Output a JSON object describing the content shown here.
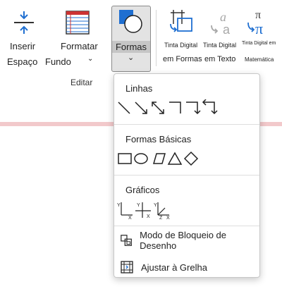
{
  "ribbon": {
    "inserir_espaco": [
      "Inserir",
      "Espaço"
    ],
    "formatar_fundo": [
      "Formatar",
      "Fundo"
    ],
    "formas": "Formas",
    "tinta_formas": [
      "Tinta Digital",
      "em Formas"
    ],
    "tinta_texto": [
      "Tinta Digital",
      "em Texto"
    ],
    "tinta_matematica": [
      "Tinta Digital em",
      "Matemática"
    ],
    "group_label": "Editar"
  },
  "menu": {
    "lines_heading": "Linhas",
    "line_items": [
      "line",
      "arrow",
      "double-arrow",
      "elbow",
      "elbow-arrow",
      "elbow-double-arrow"
    ],
    "basic_heading": "Formas Básicas",
    "basic_items": [
      "rectangle",
      "ellipse",
      "parallelogram",
      "triangle",
      "diamond"
    ],
    "graphs_heading": "Gráficos",
    "graph_items": [
      "graph-xy",
      "graph-xy-cross",
      "graph-xyz"
    ],
    "lock_label": "Modo de Bloqueio de Desenho",
    "snap_label": "Ajustar à Grelha"
  },
  "colors": {
    "accent": "#1f6fd1",
    "pink_line": "#f2c9cb",
    "disabled": "#a8a8a8"
  }
}
